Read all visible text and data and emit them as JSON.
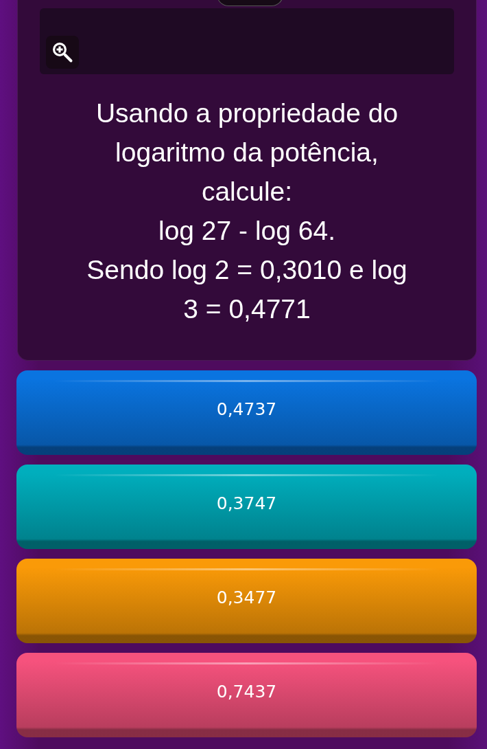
{
  "question": {
    "lines": [
      "Usando a propriedade do",
      "logaritmo da potência,",
      "calcule:",
      "log 27 - log 64.",
      "Sendo log 2 = 0,3010 e log",
      "3 = 0,4771"
    ]
  },
  "answers": [
    {
      "label": "0,4737",
      "color": "#0a74e0"
    },
    {
      "label": "0,3747",
      "color": "#00aebd"
    },
    {
      "label": "0,3477",
      "color": "#fa9a08"
    },
    {
      "label": "0,7437",
      "color": "#f6527d"
    }
  ]
}
